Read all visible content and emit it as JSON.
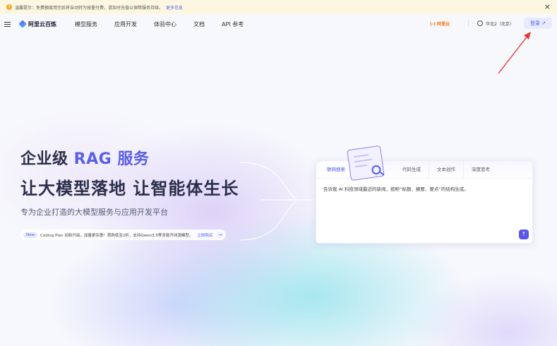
{
  "notice": {
    "text": "温馨提示：免费额度用完后将自动转为按量付费，请及时充值以保障服务持续。",
    "more_link": "更多信息"
  },
  "header": {
    "logo_text": "阿里云百炼",
    "nav": [
      "模型服务",
      "应用开发",
      "体验中心",
      "文档",
      "API 参考"
    ],
    "brand": "(-) 阿里云",
    "region": "华北2（北京）",
    "login": "登录 ↗"
  },
  "hero": {
    "title_prefix": "企业级 ",
    "title_accent": "RAG 服务",
    "title2": "让大模型落地  让智能体生长",
    "subtitle": "专为企业打造的大模型服务与应用开发平台"
  },
  "promo": {
    "badge": "New",
    "text": "Coding Plan 迎新升级，加量更实惠！首购低至2折，支持Qwen3.5等多款开闭源模型。",
    "link": "立即购买"
  },
  "chat": {
    "tabs": [
      "联网搜索",
      "代码生成",
      "文本创作",
      "深度思考"
    ],
    "prompt": "告诉我 AI 科技领域最近的新闻，按照“标题、摘要、要点”的结构生成。",
    "send_symbol": "↑"
  },
  "colors": {
    "accent": "#5b5fe6",
    "login_bg": "#e8ebff",
    "notice_bg": "#fdf7e1",
    "arrow": "#e53935"
  }
}
